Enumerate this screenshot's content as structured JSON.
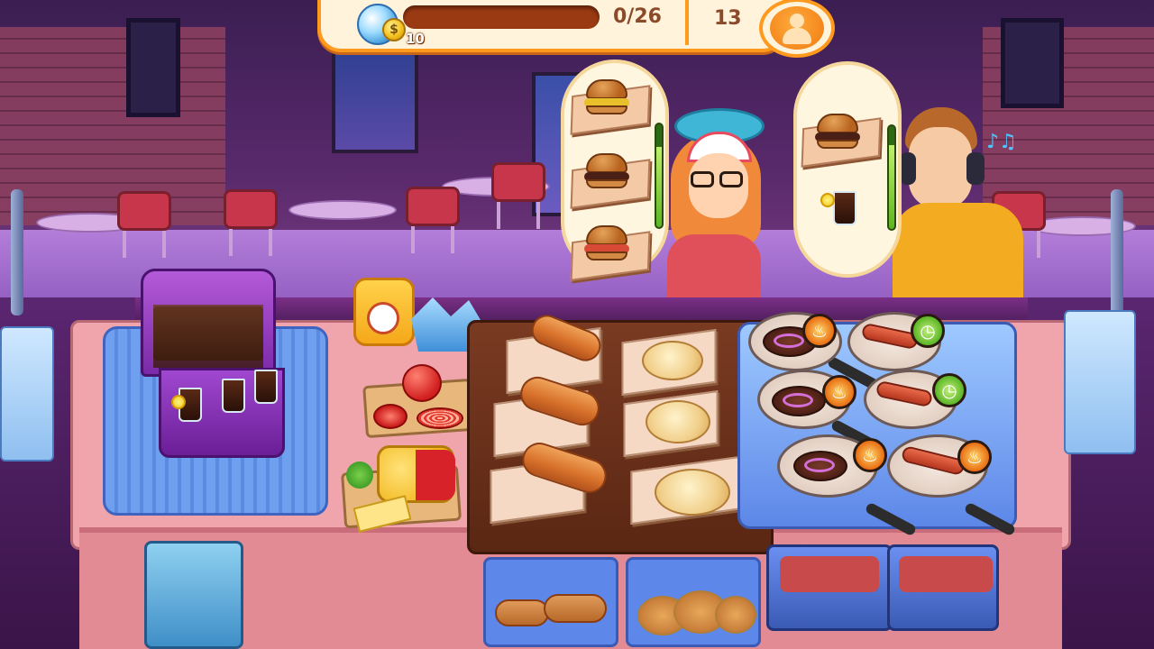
{
  "hud": {
    "coin_amount": "10",
    "goal_progress_text": "0/26",
    "goal_progress_fraction": 0.0,
    "customers_count": "13",
    "coin_icon": "coin-icon",
    "customer_icon": "customer-icon"
  },
  "orders": [
    {
      "customer": "customer-girl-hat",
      "items": [
        "burger",
        "burger",
        "burger"
      ],
      "patience_fraction": 0.78
    },
    {
      "customer": "customer-boy-headphones",
      "items": [
        "burger",
        "cola-drink"
      ],
      "patience_fraction": 0.82
    }
  ],
  "grill_pans": [
    {
      "item": "patty",
      "status": "fire"
    },
    {
      "item": "sausage",
      "status": "clock"
    },
    {
      "item": "patty",
      "status": "fire"
    },
    {
      "item": "sausage",
      "status": "clock"
    },
    {
      "item": "patty",
      "status": "fire"
    },
    {
      "item": "sausage",
      "status": "fire"
    }
  ],
  "colors": {
    "hud_border": "#ff9a1f",
    "hud_panel": "#fff3dc",
    "counter": "#f0a5ad",
    "tray": "#5d87e8"
  }
}
